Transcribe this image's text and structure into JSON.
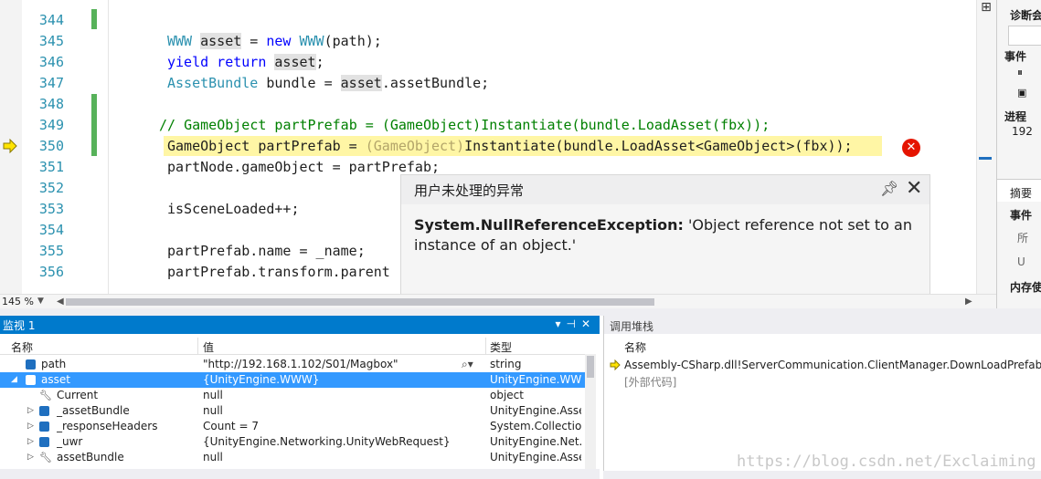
{
  "editor": {
    "zoom": "145 %",
    "lines": [
      {
        "num": "344"
      },
      {
        "num": "345"
      },
      {
        "num": "346"
      },
      {
        "num": "347"
      },
      {
        "num": "348"
      },
      {
        "num": "349"
      },
      {
        "num": "350"
      },
      {
        "num": "351"
      },
      {
        "num": "352"
      },
      {
        "num": "353"
      },
      {
        "num": "354"
      },
      {
        "num": "355"
      },
      {
        "num": "356"
      }
    ],
    "code": {
      "l345_type": "WWW",
      "l345_var": "asset",
      "l345_eq": " = ",
      "l345_new": "new",
      "l345_ctor": "WWW",
      "l345_rest": "(path);",
      "l346_kw": "yield return",
      "l346_var": "asset",
      "l346_end": ";",
      "l347_type": "AssetBundle",
      "l347_mid": " bundle = ",
      "l347_var": "asset",
      "l347_rest": ".assetBundle;",
      "l349": "// GameObject partPrefab = (GameObject)Instantiate(bundle.LoadAsset(fbx));",
      "l350_a": "GameObject partPrefab = ",
      "l350_cast": "(GameObject)",
      "l350_b": "Instantiate(bundle.LoadAsset<GameObject>(fbx));",
      "l351": "partNode.gameObject = partPrefab;",
      "l353": "isSceneLoaded++;",
      "l355": "partPrefab.name = _name;",
      "l356": "partPrefab.transform.parent"
    }
  },
  "exception": {
    "title": "用户未处理的异常",
    "type": "System.NullReferenceException:",
    "message": " 'Object reference not set to an instance of an object.'"
  },
  "diagnostics": {
    "title": "诊断会",
    "events_header": "事件",
    "process_header": "进程",
    "process_value": "192",
    "summary_tab": "摘要",
    "events_label": "事件",
    "row1": "所",
    "row2": "U",
    "memory_label": "内存使"
  },
  "watch": {
    "title": "监视 1",
    "columns": {
      "name": "名称",
      "value": "值",
      "type": "类型"
    },
    "rows": [
      {
        "name": "path",
        "value": "\"http://192.168.1.102/S01/Magbox\"",
        "type": "string",
        "expander": "",
        "selected": false
      },
      {
        "name": "asset",
        "value": "{UnityEngine.WWW}",
        "type": "UnityEngine.WWW",
        "expander": "◢",
        "selected": true
      },
      {
        "name": "Current",
        "value": "null",
        "type": "object",
        "expander": "",
        "selected": false
      },
      {
        "name": "_assetBundle",
        "value": "null",
        "type": "UnityEngine.Asse...",
        "expander": "▷",
        "selected": false
      },
      {
        "name": "_responseHeaders",
        "value": "Count = 7",
        "type": "System.Collectio...",
        "expander": "▷",
        "selected": false
      },
      {
        "name": "_uwr",
        "value": "{UnityEngine.Networking.UnityWebRequest}",
        "type": "UnityEngine.Net...",
        "expander": "▷",
        "selected": false
      },
      {
        "name": "assetBundle",
        "value": "null",
        "type": "UnityEngine.Asse...",
        "expander": "▷",
        "selected": false
      }
    ]
  },
  "callstack": {
    "title": "调用堆栈",
    "column": "名称",
    "frame1": "Assembly-CSharp.dll!ServerCommunication.ClientManager.DownLoadPrefabOfScene(",
    "frame2": "[外部代码]"
  },
  "watermark": "https://blog.csdn.net/Exclaiming"
}
